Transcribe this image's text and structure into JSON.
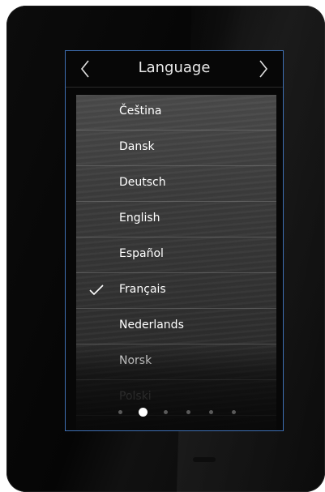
{
  "header": {
    "title": "Language",
    "prev_icon": "chevron-left-icon",
    "next_icon": "chevron-right-icon"
  },
  "languages": [
    {
      "label": "Čeština",
      "selected": false
    },
    {
      "label": "Dansk",
      "selected": false
    },
    {
      "label": "Deutsch",
      "selected": false
    },
    {
      "label": "English",
      "selected": false
    },
    {
      "label": "Español",
      "selected": false
    },
    {
      "label": "Français",
      "selected": true
    },
    {
      "label": "Nederlands",
      "selected": false
    },
    {
      "label": "Norsk",
      "selected": false
    },
    {
      "label": "Polski",
      "selected": false
    }
  ],
  "selected_icon": "checkmark-icon",
  "pagination": {
    "count": 6,
    "active_index": 1
  },
  "colors": {
    "screen_border": "#3e6fb3",
    "text": "#ffffff",
    "dot_active": "#ffffff",
    "dot_inactive": "#5a5a5a"
  }
}
